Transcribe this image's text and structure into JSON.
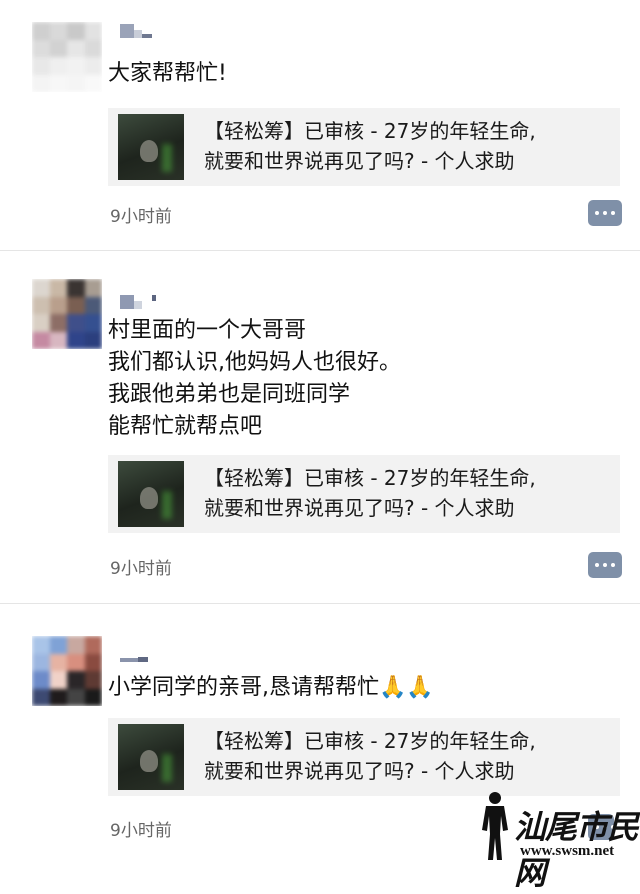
{
  "posts": [
    {
      "text": "大家帮帮忙!",
      "link": {
        "title": "【轻松筹】已审核 - 27岁的年轻生命,\n就要和世界说再见了吗? - 个人求助"
      },
      "time": "9小时前"
    },
    {
      "text": "村里面的一个大哥哥\n我们都认识,他妈妈人也很好。\n我跟他弟弟也是同班同学\n能帮忙就帮点吧",
      "link": {
        "title": "【轻松筹】已审核 - 27岁的年轻生命,\n就要和世界说再见了吗? - 个人求助"
      },
      "time": "9小时前"
    },
    {
      "text": "小学同学的亲哥,恳请帮帮忙🙏🙏",
      "link": {
        "title": "【轻松筹】已审核 - 27岁的年轻生命,\n就要和世界说再见了吗? - 个人求助"
      },
      "time": "9小时前"
    }
  ],
  "watermark": {
    "title": "汕尾市民网",
    "url": "www.swsm.net"
  },
  "icons": {
    "comment": "comment-dots-icon",
    "avatar": "blurred-avatar-image",
    "thumbnail": "link-thumbnail-image"
  },
  "colors": {
    "link_card_bg": "#f2f2f2",
    "timestamp": "#666666",
    "comment_button": "#7f90a8"
  }
}
